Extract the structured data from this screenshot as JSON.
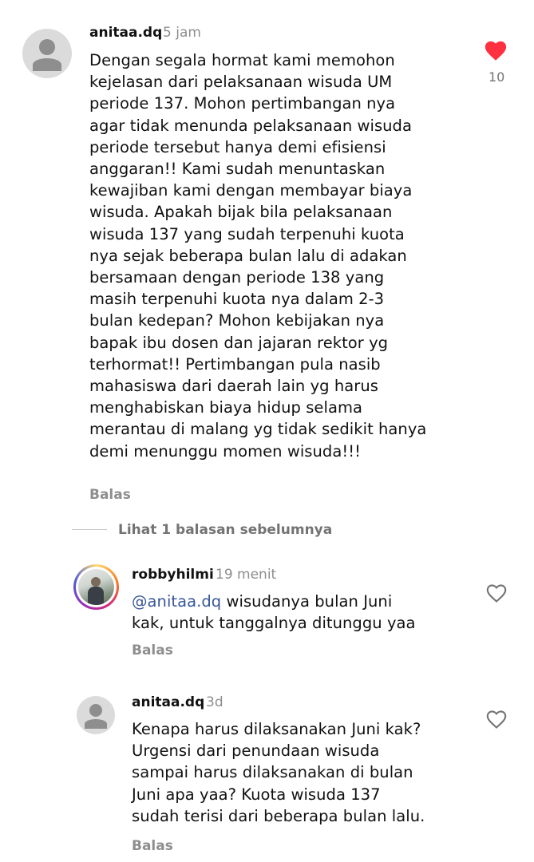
{
  "comments": [
    {
      "username": "anitaa.dq",
      "time": "5 jam",
      "lines": [
        "Dengan segala hormat kami memohon",
        "kejelasan dari pelaksanaan wisuda UM",
        "periode 137. Mohon pertimbangan nya",
        "agar tidak menunda pelaksanaan wisuda",
        "periode tersebut hanya demi efisiensi",
        "anggaran!! Kami sudah menuntaskan",
        "kewajiban kami dengan membayar biaya",
        "wisuda. Apakah bijak bila pelaksanaan",
        "wisuda 137 yang sudah terpenuhi kuota",
        "nya sejak beberapa bulan lalu di adakan",
        "bersamaan dengan periode 138 yang",
        "masih terpenuhi kuota nya dalam 2-3",
        "bulan kedepan? Mohon kebijakan nya",
        "bapak ibu dosen dan jajaran rektor yg",
        "terhormat!! Pertimbangan pula nasib",
        "mahasiswa dari daerah lain yg harus",
        "menghabiskan biaya hidup selama",
        "merantau di malang yg tidak sedikit hanya",
        "demi menunggu momen wisuda!!!"
      ],
      "reply_label": "Balas",
      "like_count": "10",
      "liked": true,
      "icon": "heart-filled-icon"
    }
  ],
  "view_replies": "Lihat 1 balasan sebelumnya",
  "replies": [
    {
      "username": "robbyhilmi",
      "time": "19 menit",
      "mention": "@anitaa.dq",
      "line1_rest": " wisudanya bulan Juni",
      "line2": "kak, untuk tanggalnya ditunggu yaa",
      "reply_label": "Balas",
      "icon": "heart-outline-icon"
    },
    {
      "username": "anitaa.dq",
      "time": "3d",
      "lines": [
        "Kenapa harus dilaksanakan Juni kak?",
        "Urgensi dari penundaan wisuda",
        "sampai harus dilaksanakan di bulan",
        "Juni apa yaa? Kuota wisuda 137",
        "sudah terisi dari beberapa bulan lalu."
      ],
      "reply_label": "Balas",
      "icon": "heart-outline-icon"
    }
  ],
  "colors": {
    "like_red": "#ff3040",
    "mention_blue": "#385898",
    "muted": "#8e8e8e",
    "story_ring": [
      "#feda75",
      "#fa7e1e",
      "#d62976",
      "#962fbf"
    ]
  }
}
